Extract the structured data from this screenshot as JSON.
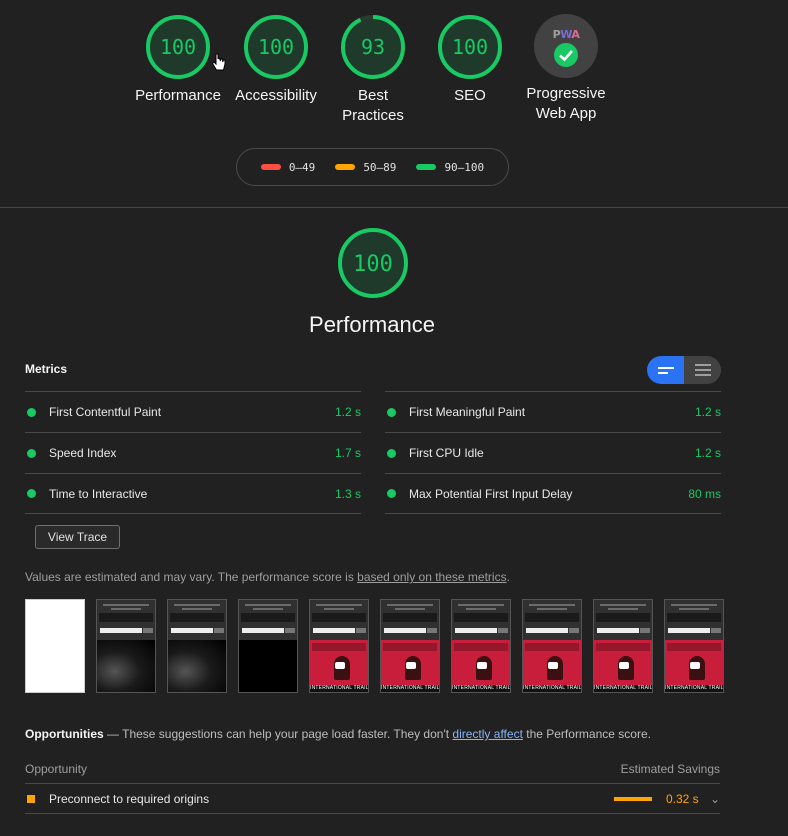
{
  "colors": {
    "background": "#212121",
    "pass": "#18c964",
    "average": "#ffa400",
    "fail": "#ff4e42",
    "toggle_active": "#2b73f5"
  },
  "gauges": [
    {
      "score": "100",
      "fraction": 1.0,
      "label": "Performance"
    },
    {
      "score": "100",
      "fraction": 1.0,
      "label": "Accessibility"
    },
    {
      "score": "93",
      "fraction": 0.93,
      "label": "Best Practices"
    },
    {
      "score": "100",
      "fraction": 1.0,
      "label": "SEO"
    },
    {
      "label": "Progressive Web App",
      "badge_text": "PWA",
      "icon": "check-icon"
    }
  ],
  "legend": [
    {
      "range": "0–49",
      "color": "#ff4e42"
    },
    {
      "range": "50–89",
      "color": "#ffa400"
    },
    {
      "range": "90–100",
      "color": "#18c964"
    }
  ],
  "performance": {
    "score": "100",
    "fraction": 1.0,
    "title": "Performance"
  },
  "metrics": {
    "header": "Metrics",
    "left": [
      {
        "label": "First Contentful Paint",
        "value": "1.2 s"
      },
      {
        "label": "Speed Index",
        "value": "1.7 s"
      },
      {
        "label": "Time to Interactive",
        "value": "1.3 s"
      }
    ],
    "right": [
      {
        "label": "First Meaningful Paint",
        "value": "1.2 s"
      },
      {
        "label": "First CPU Idle",
        "value": "1.2 s"
      },
      {
        "label": "Max Potential First Input Delay",
        "value": "80 ms"
      }
    ]
  },
  "view_trace_label": "View Trace",
  "note": {
    "prefix": "Values are estimated and may vary. The performance score is ",
    "link": "based only on these metrics",
    "suffix": "."
  },
  "filmstrip": {
    "caption": "INTERNATIONAL TRAILER"
  },
  "opportunities": {
    "title": "Opportunities",
    "dash": " — ",
    "desc_prefix": "These suggestions can help your page load faster. They don't ",
    "desc_link": "directly affect",
    "desc_suffix": " the Performance score.",
    "col_opportunity": "Opportunity",
    "col_savings": "Estimated Savings",
    "items": [
      {
        "label": "Preconnect to required origins",
        "savings": "0.32 s"
      }
    ]
  }
}
